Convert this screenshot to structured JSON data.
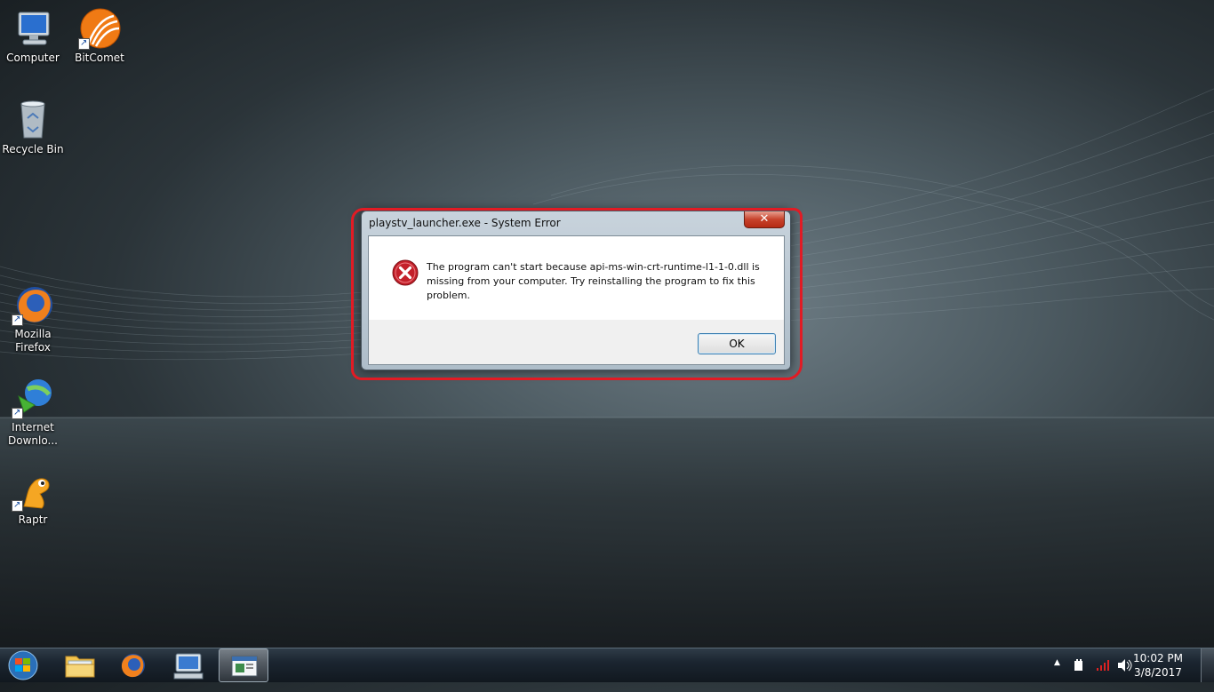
{
  "desktop": {
    "icons": [
      {
        "label": "Computer"
      },
      {
        "label": "BitComet"
      },
      {
        "label": "Recycle Bin"
      },
      {
        "label": "Mozilla Firefox"
      },
      {
        "label": "Internet Downlo..."
      },
      {
        "label": "Raptr"
      }
    ]
  },
  "dialog": {
    "title": "playstv_launcher.exe - System Error",
    "close_glyph": "✕",
    "message": "The program can't start because api-ms-win-crt-runtime-l1-1-0.dll is missing from your computer. Try reinstalling the program to fix this problem.",
    "ok_label": "OK",
    "highlight_color": "#e11b24"
  },
  "taskbar": {
    "pinned": [
      "start-orb",
      "windows-explorer",
      "firefox",
      "remote-desktop",
      "active-window"
    ],
    "tray": {
      "show_hidden": "▲",
      "time": "10:02 PM",
      "date": "3/8/2017"
    }
  }
}
